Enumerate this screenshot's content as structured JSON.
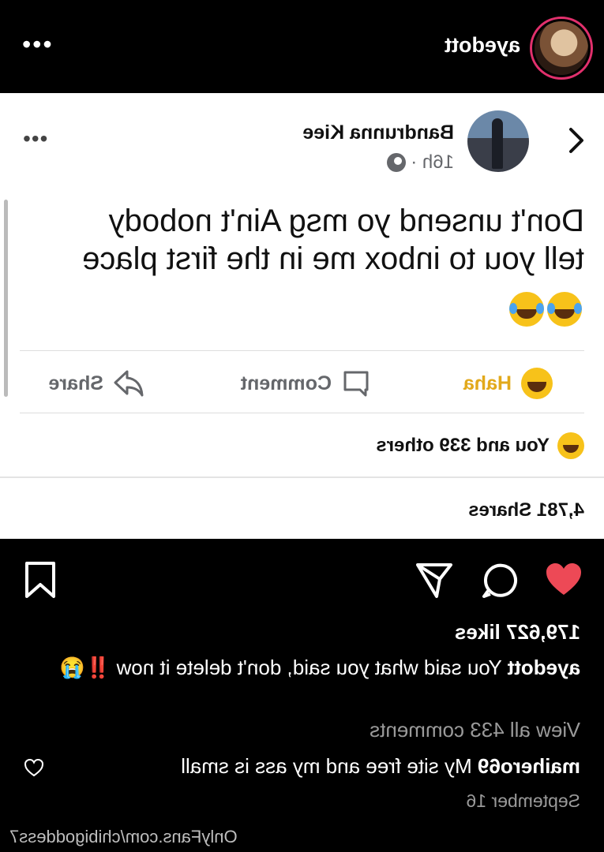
{
  "instagram": {
    "username": "ayedott",
    "more_icon": "•••",
    "likes": "179,627 likes",
    "caption": {
      "username": "ayedott",
      "text": "You said what you said, don't delete it now",
      "emoji": "‼️😭"
    },
    "view_all_comments": "View all 433 comments",
    "comment": {
      "username": "maihero69",
      "text": "My site free and my ass is small"
    },
    "date": "September 16",
    "watermark": "OnlyFans.com/chibigoddess7",
    "colors": {
      "heart": "#ed4956",
      "story_ring": "#e1306c",
      "background": "#000000"
    },
    "icons": [
      "heart-icon",
      "comment-icon",
      "send-icon",
      "bookmark-icon",
      "small-heart-icon"
    ]
  },
  "facebook_post": {
    "author": "Bandrunna Kiee",
    "time": "16h ·",
    "more_icon": "•••",
    "text_lines": [
      "Don't unsend yo msg Ain't nobody",
      "tell you to inbox me in the first place"
    ],
    "reaction_emoji_count": 2,
    "actions": {
      "haha": "Haha",
      "comment": "Comment",
      "share": "Share"
    },
    "reactors": "You and 339 others",
    "shares": "4,781 Shares",
    "colors": {
      "haha": "#e2a91b",
      "muted": "#65676b"
    }
  }
}
